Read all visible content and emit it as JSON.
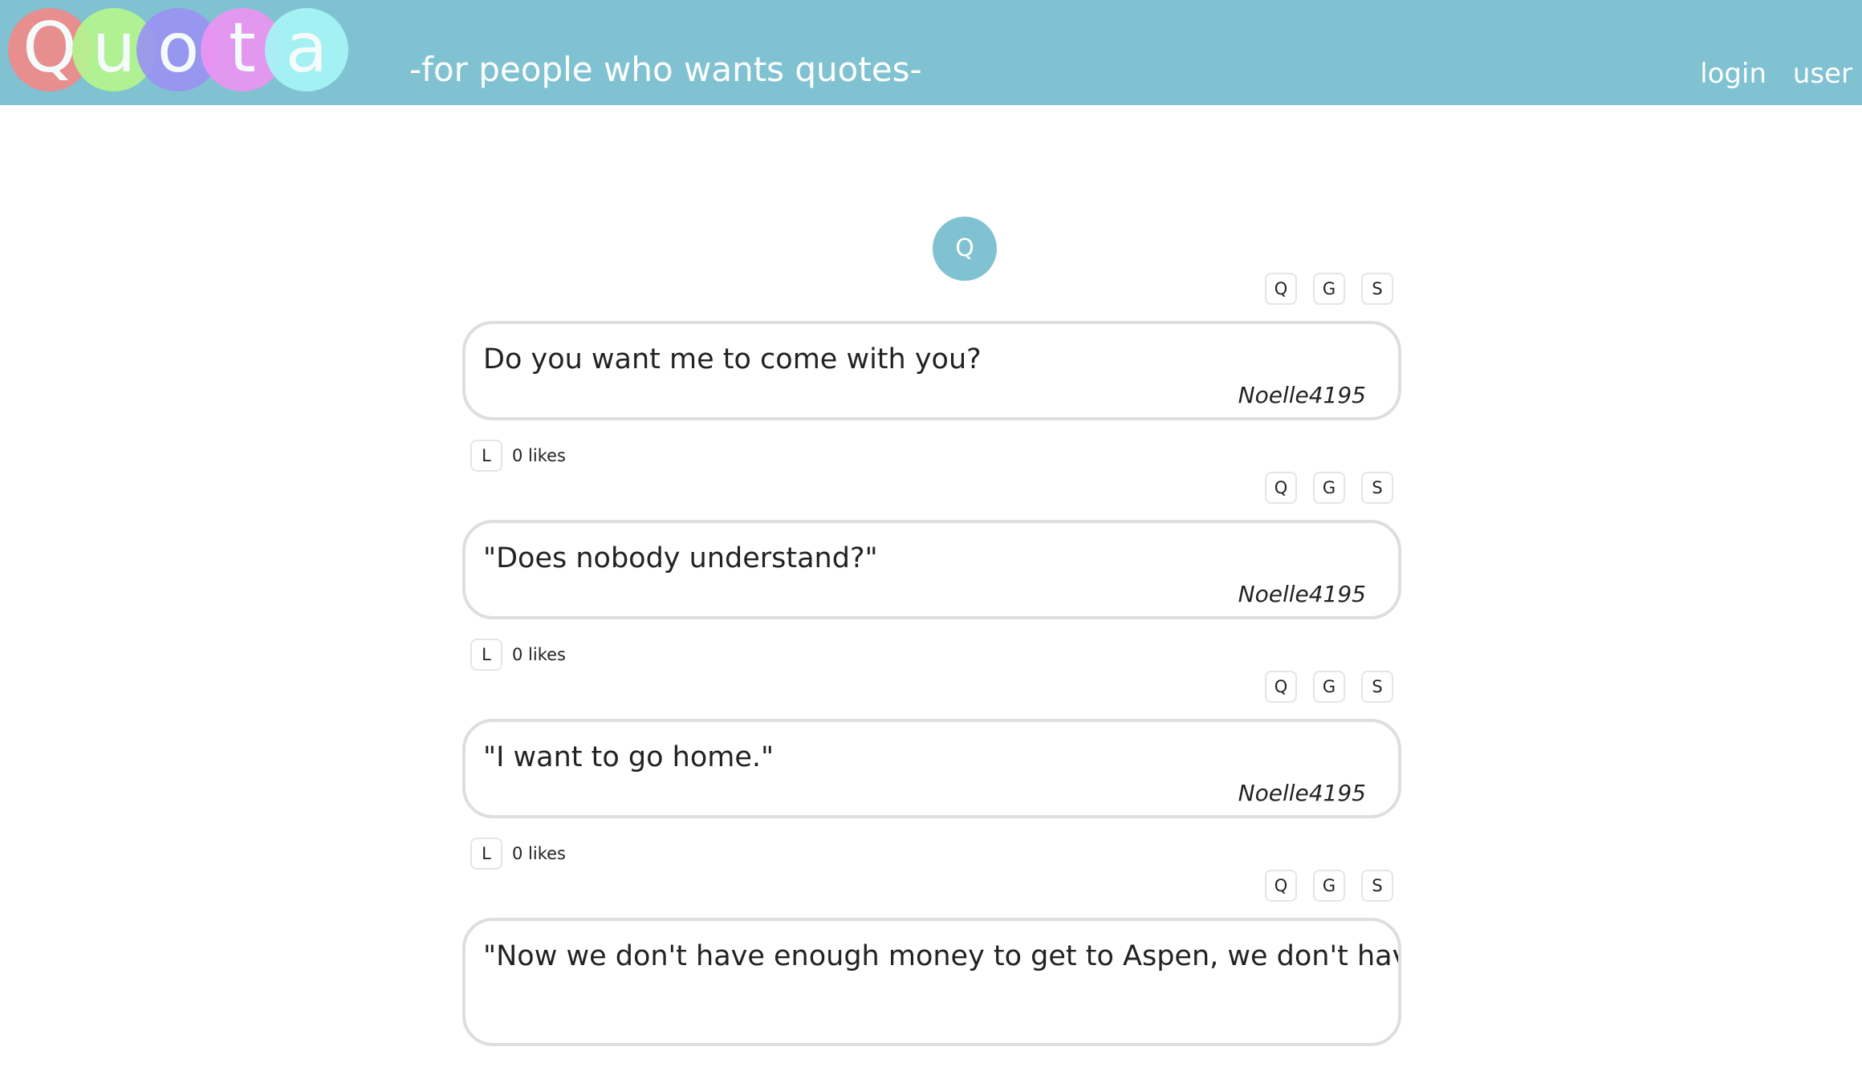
{
  "header": {
    "logo_letters": [
      {
        "char": "Q",
        "color": "#f08a8a"
      },
      {
        "char": "u",
        "color": "#b5f58f"
      },
      {
        "char": "o",
        "color": "#9a94f2"
      },
      {
        "char": "t",
        "color": "#ec95f2"
      },
      {
        "char": "a",
        "color": "#a6f5f5"
      }
    ],
    "tagline": "-for people who wants quotes-",
    "nav_login": "login",
    "nav_user": "user",
    "background": "#80c2d2"
  },
  "avatar_label": "Q",
  "button_labels": {
    "q": "Q",
    "g": "G",
    "s": "S",
    "like": "L"
  },
  "posts": [
    {
      "quote": "Do you want me to come with you?",
      "author": "Noelle4195",
      "likes": "0 likes"
    },
    {
      "quote": "\"Does nobody understand?\"",
      "author": "Noelle4195",
      "likes": "0 likes"
    },
    {
      "quote": "\"I want to go home.\"",
      "author": "Noelle4195",
      "likes": "0 likes"
    },
    {
      "quote": "\"Now we don't have enough money to get to Aspen, we don't have",
      "author": "",
      "likes": ""
    }
  ]
}
